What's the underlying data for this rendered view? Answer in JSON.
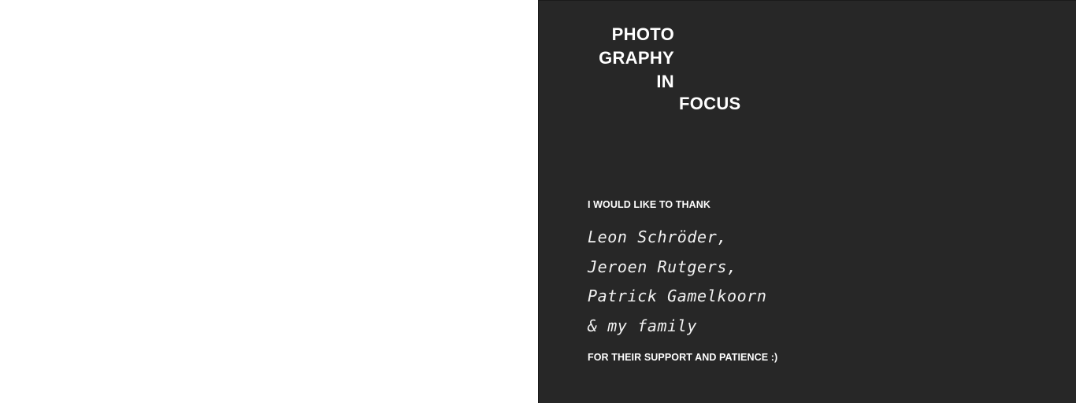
{
  "spread": {
    "left_page_color": "#ffffff",
    "right_page_color": "#272727"
  },
  "title": {
    "lines": [
      "PHOTO",
      "GRAPHY",
      "IN",
      "FOCUS"
    ]
  },
  "acknowledgements": {
    "intro": "I WOULD LIKE TO THANK",
    "names": [
      "Leon Schröder,",
      "Jeroen Rutgers,",
      "Patrick Gamelkoorn",
      "& my family"
    ],
    "outro": "FOR THEIR SUPPORT AND PATIENCE :)"
  }
}
